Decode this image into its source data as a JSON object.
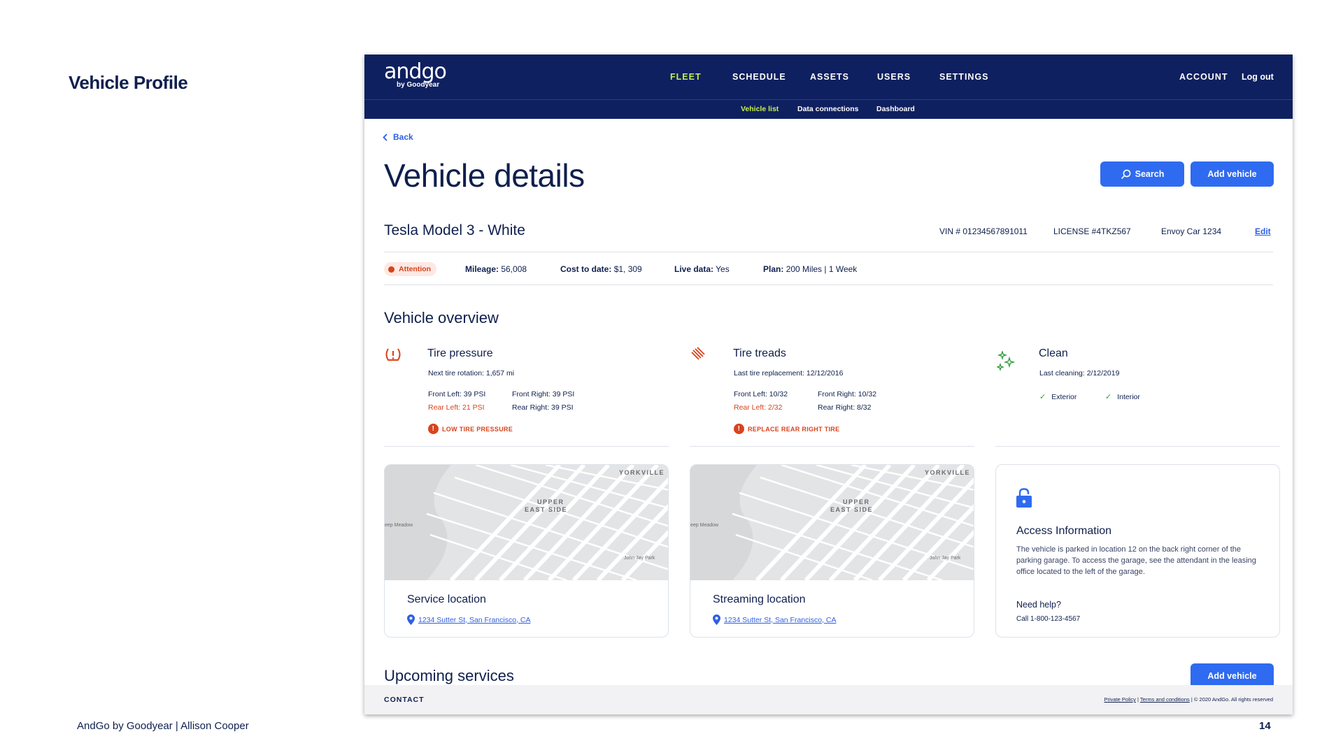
{
  "slide": {
    "title": "Vehicle Profile",
    "footer": "AndGo by Goodyear | Allison Cooper",
    "page_number": "14"
  },
  "app": {
    "logo": "andgo",
    "logo_sub": "by Goodyear",
    "nav": [
      "FLEET",
      "SCHEDULE",
      "ASSETS",
      "USERS",
      "SETTINGS"
    ],
    "account": "ACCOUNT",
    "logout": "Log out",
    "subnav": [
      "Vehicle list",
      "Data connections",
      "Dashboard"
    ]
  },
  "page": {
    "back": "Back",
    "title": "Vehicle details",
    "search_label": "Search",
    "add_vehicle_label": "Add vehicle"
  },
  "vehicle": {
    "name": "Tesla Model 3 - White",
    "vin": "VIN # 01234567891011",
    "license": "LICENSE #4TKZ567",
    "envoy": "Envoy Car 1234",
    "edit": "Edit",
    "status": "Attention",
    "stats": [
      {
        "label": "Mileage:",
        "value": "56,008"
      },
      {
        "label": "Cost to date:",
        "value": "$1, 309"
      },
      {
        "label": "Live data:",
        "value": "Yes"
      },
      {
        "label": "Plan:",
        "value": "200 Miles  |  1 Week"
      }
    ]
  },
  "overview": {
    "heading": "Vehicle overview",
    "tire_pressure": {
      "title": "Tire pressure",
      "sub": "Next tire rotation: 1,657 mi",
      "front_left": "Front Left: 39 PSI",
      "front_right": "Front Right: 39 PSI",
      "rear_left": "Rear Left: 21 PSI",
      "rear_right": "Rear Right: 39 PSI",
      "warning": "LOW TIRE PRESSURE"
    },
    "tire_treads": {
      "title": "Tire treads",
      "sub": "Last tire replacement: 12/12/2016",
      "front_left": "Front Left: 10/32",
      "front_right": "Front Right: 10/32",
      "rear_left": "Rear Left: 2/32",
      "rear_right": "Rear Right: 8/32",
      "warning": "REPLACE REAR RIGHT TIRE"
    },
    "clean": {
      "title": "Clean",
      "sub": "Last cleaning: 2/12/2019",
      "exterior": "Exterior",
      "interior": "Interior"
    }
  },
  "map_labels": {
    "yorkville": "YORKVILLE",
    "upper": "UPPER",
    "east_side": "EAST SIDE",
    "meadow": "eep Meadow",
    "park": "John Jay Park"
  },
  "locations": {
    "service": {
      "title": "Service location",
      "address": "1234 Sutter St, San Francisco, CA"
    },
    "streaming": {
      "title": "Streaming location",
      "address": "1234 Sutter St, San Francisco, CA"
    }
  },
  "access": {
    "title": "Access Information",
    "text": "The vehicle is parked in location 12 on the back right corner of the parking garage. To access the garage, see the attendant in the leasing office located to the left of the garage.",
    "help_title": "Need help?",
    "help_text": "Call 1-800-123-4567"
  },
  "upcoming": {
    "heading": "Upcoming services",
    "add_vehicle_label": "Add vehicle"
  },
  "footer": {
    "contact": "CONTACT",
    "privacy": "Private Policy",
    "terms": "Terms and conditions",
    "copyright": "| © 2020 AndGo. All rights reserved"
  },
  "colors": {
    "navy": "#0f2060",
    "accent_green": "#c6f04d",
    "primary_blue": "#2f6bf0",
    "alert_red": "#d8431c",
    "success_green": "#2f9b3c"
  }
}
